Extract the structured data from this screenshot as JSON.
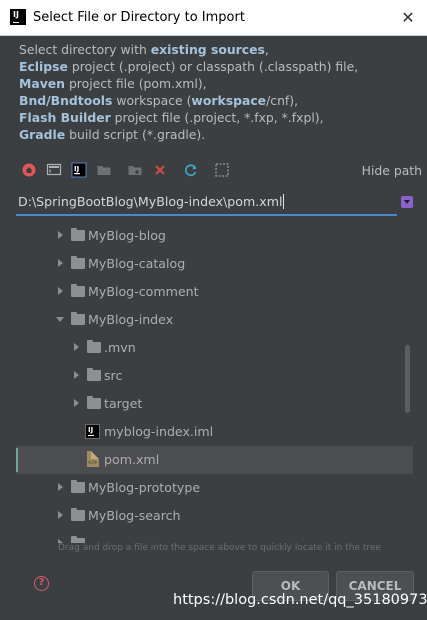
{
  "window": {
    "title": "Select File or Directory to Import",
    "close_glyph": "✕"
  },
  "description": {
    "l1_pre": "Select directory with ",
    "l1_bold": "existing sources",
    "l1_post": ",",
    "l2_bold": "Eclipse",
    "l2_post": " project (.project) or classpath (.classpath) file,",
    "l3_bold": "Maven",
    "l3_post": " project file (pom.xml),",
    "l4_bold": "Bnd/Bndtools",
    "l4_mid": " workspace (",
    "l4_bold2": "workspace",
    "l4_post": "/cnf),",
    "l5_bold": "Flash Builder",
    "l5_post": " project file (.project, *.fxp, *.fxpl),",
    "l6_bold": "Gradle",
    "l6_post": " build script (*.gradle)."
  },
  "toolbar": {
    "icons": [
      "home-icon",
      "desktop-icon",
      "project-icon",
      "folder-icon",
      "new-folder-icon",
      "delete-icon",
      "refresh-icon",
      "show-hidden-icon"
    ],
    "hide_path_label": "Hide path"
  },
  "path_field": {
    "value": "D:\\SpringBootBlog\\MyBlog-index\\pom.xml"
  },
  "tree": {
    "rows": [
      {
        "label": "MyBlog-blog",
        "type": "folder",
        "state": "collapsed"
      },
      {
        "label": "MyBlog-catalog",
        "type": "folder",
        "state": "collapsed"
      },
      {
        "label": "MyBlog-comment",
        "type": "folder",
        "state": "collapsed"
      },
      {
        "label": "MyBlog-index",
        "type": "folder",
        "state": "expanded"
      },
      {
        "label": ".mvn",
        "type": "folder",
        "state": "collapsed"
      },
      {
        "label": "src",
        "type": "folder",
        "state": "collapsed"
      },
      {
        "label": "target",
        "type": "folder",
        "state": "collapsed"
      },
      {
        "label": "myblog-index.iml",
        "type": "iml"
      },
      {
        "label": "pom.xml",
        "type": "xml",
        "selected": true
      },
      {
        "label": "MyBlog-prototype",
        "type": "folder",
        "state": "collapsed"
      },
      {
        "label": "MyBlog-search",
        "type": "folder",
        "state": "collapsed"
      }
    ]
  },
  "footer": {
    "hint": "Drag and drop a file into the space above to quickly locate it in the tree",
    "help_glyph": "?",
    "ok_label": "OK",
    "cancel_label": "CANCEL"
  },
  "watermark": "https://blog.csdn.net/qq_35180973",
  "colors": {
    "dialog_bg": "#3c3f41",
    "accent": "#4a88c7",
    "selection": "#4b4d50",
    "bold_text": "#a5c2dc"
  }
}
